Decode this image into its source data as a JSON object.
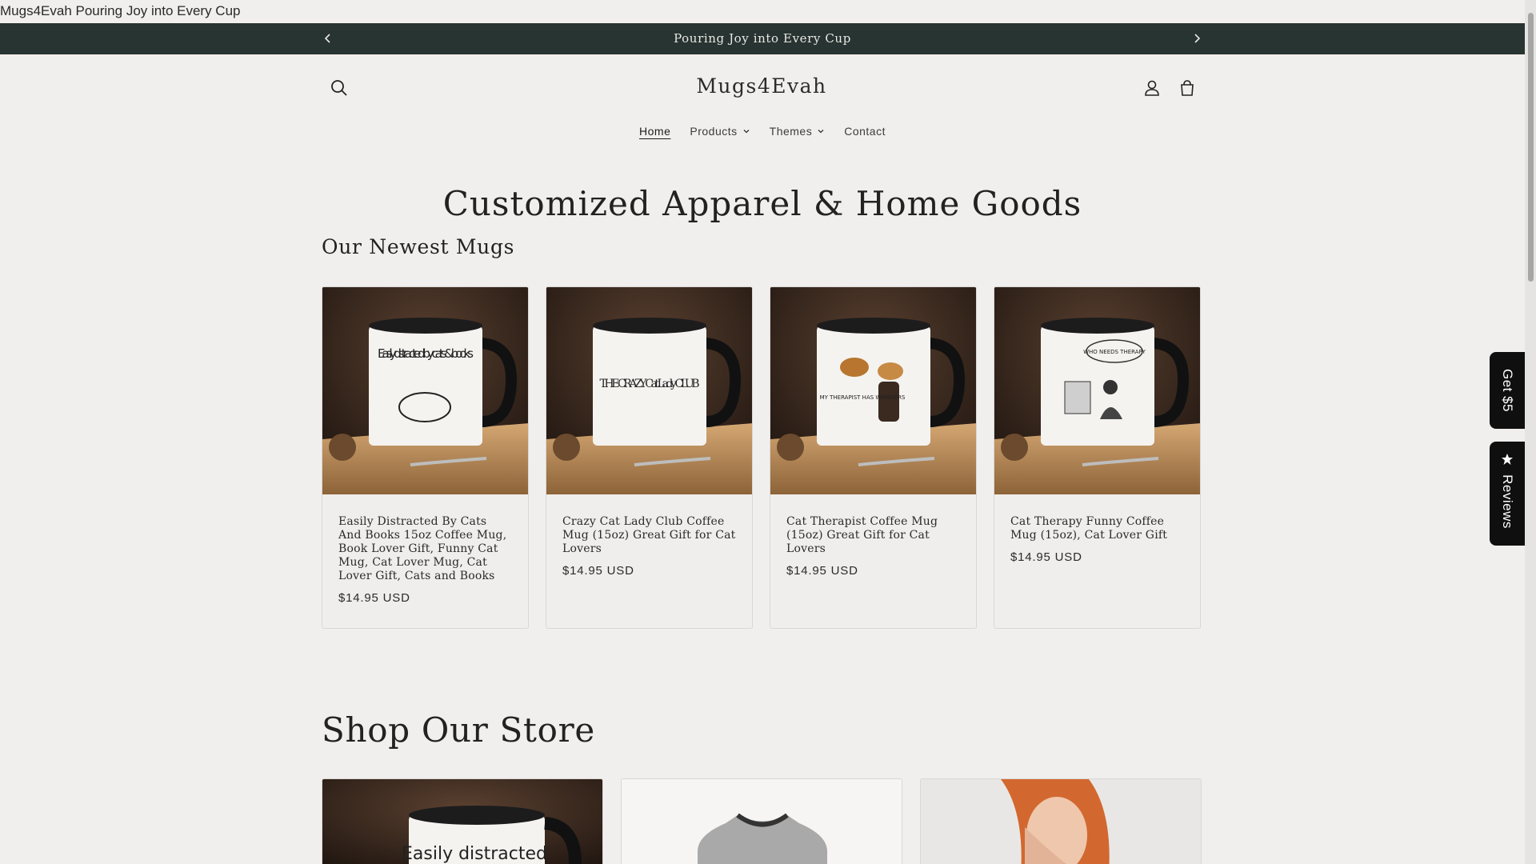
{
  "window": {
    "title": "Mugs4Evah Pouring Joy into Every Cup"
  },
  "announcement": {
    "text": "Pouring Joy into Every Cup"
  },
  "header": {
    "logo": "Mugs4Evah"
  },
  "nav": [
    {
      "label": "Home",
      "active": true
    },
    {
      "label": "Products",
      "has_dropdown": true
    },
    {
      "label": "Themes",
      "has_dropdown": true
    },
    {
      "label": "Contact"
    }
  ],
  "hero": {
    "title": "Customized Apparel & Home Goods"
  },
  "newest": {
    "title": "Our Newest Mugs",
    "products": [
      {
        "title": "Easily Distracted By Cats And Books 15oz Coffee Mug, Book Lover Gift, Funny Cat Mug, Cat Lover Mug, Cat Lover Gift, Cats and Books",
        "price": "$14.95 USD",
        "mug_text": "Easily distracted by cats & books"
      },
      {
        "title": "Crazy Cat Lady Club Coffee Mug (15oz) Great Gift for Cat Lovers",
        "price": "$14.95 USD",
        "mug_text": "THE CRAZY Cat Lady CLUB"
      },
      {
        "title": "Cat Therapist Coffee Mug (15oz) Great Gift for Cat Lovers",
        "price": "$14.95 USD",
        "mug_text": "MY THERAPIST HAS WHISKERS"
      },
      {
        "title": "Cat Therapy Funny Coffee Mug (15oz), Cat Lover Gift",
        "price": "$14.95 USD",
        "mug_text": "WHO NEEDS THERAPY"
      }
    ]
  },
  "store": {
    "title": "Shop Our Store",
    "store_card_text": "Easily distracted"
  },
  "side_tabs": {
    "get5": "Get $5",
    "reviews": "Reviews"
  },
  "colors": {
    "announcement_bg": "#283431",
    "page_bg": "#f1efed",
    "side_tab_bg": "#0f0f0f"
  }
}
